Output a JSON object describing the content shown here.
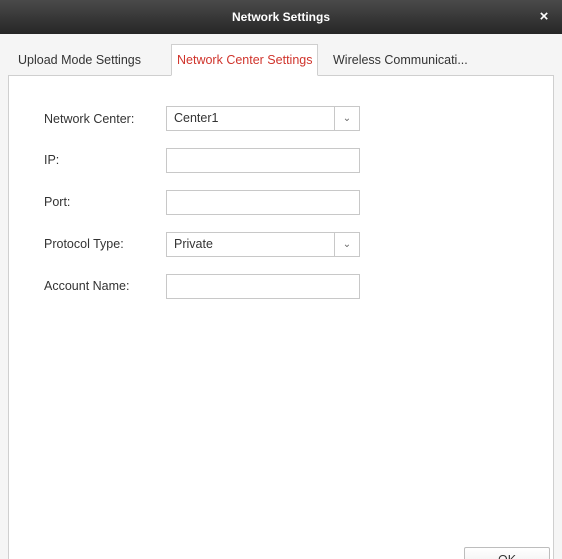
{
  "window": {
    "title": "Network Settings",
    "close_symbol": "×"
  },
  "tabs": [
    {
      "label": "Upload Mode Settings",
      "active": false
    },
    {
      "label": "Network Center Settings",
      "active": true
    },
    {
      "label": "Wireless Communicati...",
      "active": false
    }
  ],
  "form": {
    "network_center": {
      "label": "Network Center:",
      "value": "Center1"
    },
    "ip": {
      "label": "IP:",
      "value": ""
    },
    "port": {
      "label": "Port:",
      "value": ""
    },
    "protocol_type": {
      "label": "Protocol Type:",
      "value": "Private"
    },
    "account_name": {
      "label": "Account Name:",
      "value": ""
    }
  },
  "dropdown_arrow": "⌄",
  "buttons": {
    "ok_label": "OK"
  },
  "colors": {
    "active_tab_text": "#d0342c",
    "titlebar": "#2e2e2e"
  }
}
